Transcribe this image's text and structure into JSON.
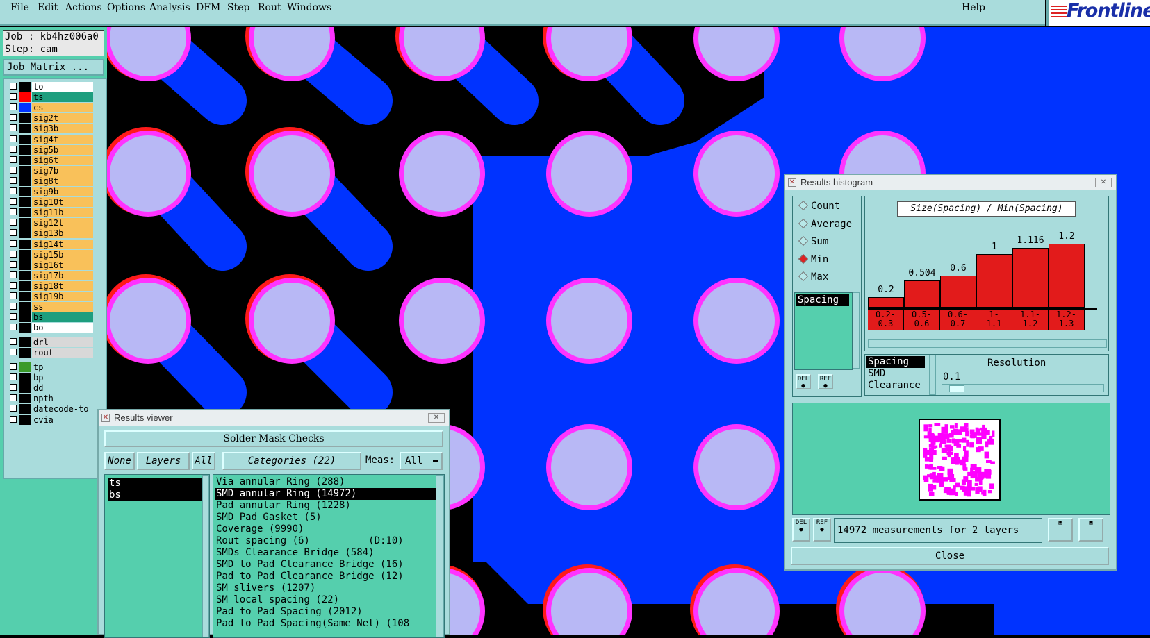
{
  "menu": {
    "items": [
      "File",
      "Edit",
      "Actions",
      "Options",
      "Analysis",
      "DFM",
      "Step",
      "Rout",
      "Windows"
    ],
    "help": "Help",
    "logo": "Frontline"
  },
  "left_panel": {
    "job_line": "Job : kb4hz006a0",
    "step_line": "Step: cam",
    "job_matrix_button": "Job Matrix ...",
    "layers": [
      {
        "name": "to",
        "bg": "#ffffff",
        "swatch": "#000000"
      },
      {
        "name": "ts",
        "bg": "#1e9e7e",
        "swatch": "#ff0000"
      },
      {
        "name": "cs",
        "bg": "#f9c15a",
        "swatch": "#0033ff"
      },
      {
        "name": "sig2t",
        "bg": "#f9c15a",
        "swatch": "#000000"
      },
      {
        "name": "sig3b",
        "bg": "#f9c15a",
        "swatch": "#000000"
      },
      {
        "name": "sig4t",
        "bg": "#f9c15a",
        "swatch": "#000000"
      },
      {
        "name": "sig5b",
        "bg": "#f9c15a",
        "swatch": "#000000"
      },
      {
        "name": "sig6t",
        "bg": "#f9c15a",
        "swatch": "#000000"
      },
      {
        "name": "sig7b",
        "bg": "#f9c15a",
        "swatch": "#000000"
      },
      {
        "name": "sig8t",
        "bg": "#f9c15a",
        "swatch": "#000000"
      },
      {
        "name": "sig9b",
        "bg": "#f9c15a",
        "swatch": "#000000"
      },
      {
        "name": "sig10t",
        "bg": "#f9c15a",
        "swatch": "#000000"
      },
      {
        "name": "sig11b",
        "bg": "#f9c15a",
        "swatch": "#000000"
      },
      {
        "name": "sig12t",
        "bg": "#f9c15a",
        "swatch": "#000000"
      },
      {
        "name": "sig13b",
        "bg": "#f9c15a",
        "swatch": "#000000"
      },
      {
        "name": "sig14t",
        "bg": "#f9c15a",
        "swatch": "#000000"
      },
      {
        "name": "sig15b",
        "bg": "#f9c15a",
        "swatch": "#000000"
      },
      {
        "name": "sig16t",
        "bg": "#f9c15a",
        "swatch": "#000000"
      },
      {
        "name": "sig17b",
        "bg": "#f9c15a",
        "swatch": "#000000"
      },
      {
        "name": "sig18t",
        "bg": "#f9c15a",
        "swatch": "#000000"
      },
      {
        "name": "sig19b",
        "bg": "#f9c15a",
        "swatch": "#000000"
      },
      {
        "name": "ss",
        "bg": "#f9c15a",
        "swatch": "#000000"
      },
      {
        "name": "bs",
        "bg": "#1e9e7e",
        "swatch": "#000000"
      },
      {
        "name": "bo",
        "bg": "#ffffff",
        "swatch": "#000000"
      }
    ],
    "drill_layers": [
      {
        "name": "drl",
        "bg": "#d8d8d8",
        "swatch": "#000000"
      },
      {
        "name": "rout",
        "bg": "#d8d8d8",
        "swatch": "#000000"
      }
    ],
    "misc_layers": [
      {
        "name": "tp",
        "bg": "#a9dcdc",
        "swatch": "#3a9a2a"
      },
      {
        "name": "bp",
        "bg": "#a9dcdc",
        "swatch": "#000000"
      },
      {
        "name": "dd",
        "bg": "#a9dcdc",
        "swatch": "#000000"
      },
      {
        "name": "npth",
        "bg": "#a9dcdc",
        "swatch": "#000000"
      },
      {
        "name": "datecode-to",
        "bg": "#a9dcdc",
        "swatch": "#000000"
      },
      {
        "name": "cvia",
        "bg": "#a9dcdc",
        "swatch": "#000000"
      }
    ]
  },
  "results_viewer": {
    "title": "Results viewer",
    "header": "Solder Mask Checks",
    "none_button": "None",
    "layers_button": "Layers",
    "all_button": "All",
    "categories_button": "Categories (22)",
    "meas_label": "Meas:",
    "meas_value": "All",
    "layers_list": [
      "ts",
      "bs"
    ],
    "categories": [
      "Via annular Ring (288)",
      "SMD annular Ring (14972)",
      "Pad annular Ring (1228)",
      "SMD Pad Gasket (5)",
      "Coverage (9990)",
      "Rout spacing (6)          (D:10)",
      "SMDs Clearance Bridge (584)",
      "SMD to Pad Clearance Bridge (16)",
      "Pad to Pad Clearance Bridge (12)",
      "SM slivers (1207)",
      "SM local spacing (22)",
      "Pad to Pad Spacing (2012)",
      "Pad to Pad Spacing(Same Net) (108"
    ],
    "selected_category_index": 1
  },
  "histogram": {
    "title": "Results histogram",
    "radio_options": [
      "Count",
      "Average",
      "Sum",
      "Min",
      "Max"
    ],
    "selected_radio": "Min",
    "measure_list": [
      "Spacing"
    ],
    "chart_title": "Size(Spacing) / Min(Spacing)",
    "type_list": [
      "Spacing",
      "SMD",
      "Clearance"
    ],
    "resolution_label": "Resolution",
    "resolution_value": "0.1",
    "summary": "14972 measurements for 2 layers",
    "close_button": "Close",
    "del_label": "DEL",
    "ref_label": "REF"
  },
  "chart_data": {
    "type": "bar",
    "title": "Size(Spacing) / Min(Spacing)",
    "categories": [
      "0.2-\n0.3",
      "0.5-\n0.6",
      "0.6-\n0.7",
      "1-\n1.1",
      "1.1-\n1.2",
      "1.2-\n1.3"
    ],
    "values": [
      0.2,
      0.504,
      0.6,
      1,
      1.116,
      1.2
    ],
    "value_labels": [
      "0.2",
      "0.504",
      "0.6",
      "1",
      "1.116",
      "1.2"
    ],
    "ylim": [
      0,
      1.3
    ],
    "bar_color": "#e21b1b"
  }
}
